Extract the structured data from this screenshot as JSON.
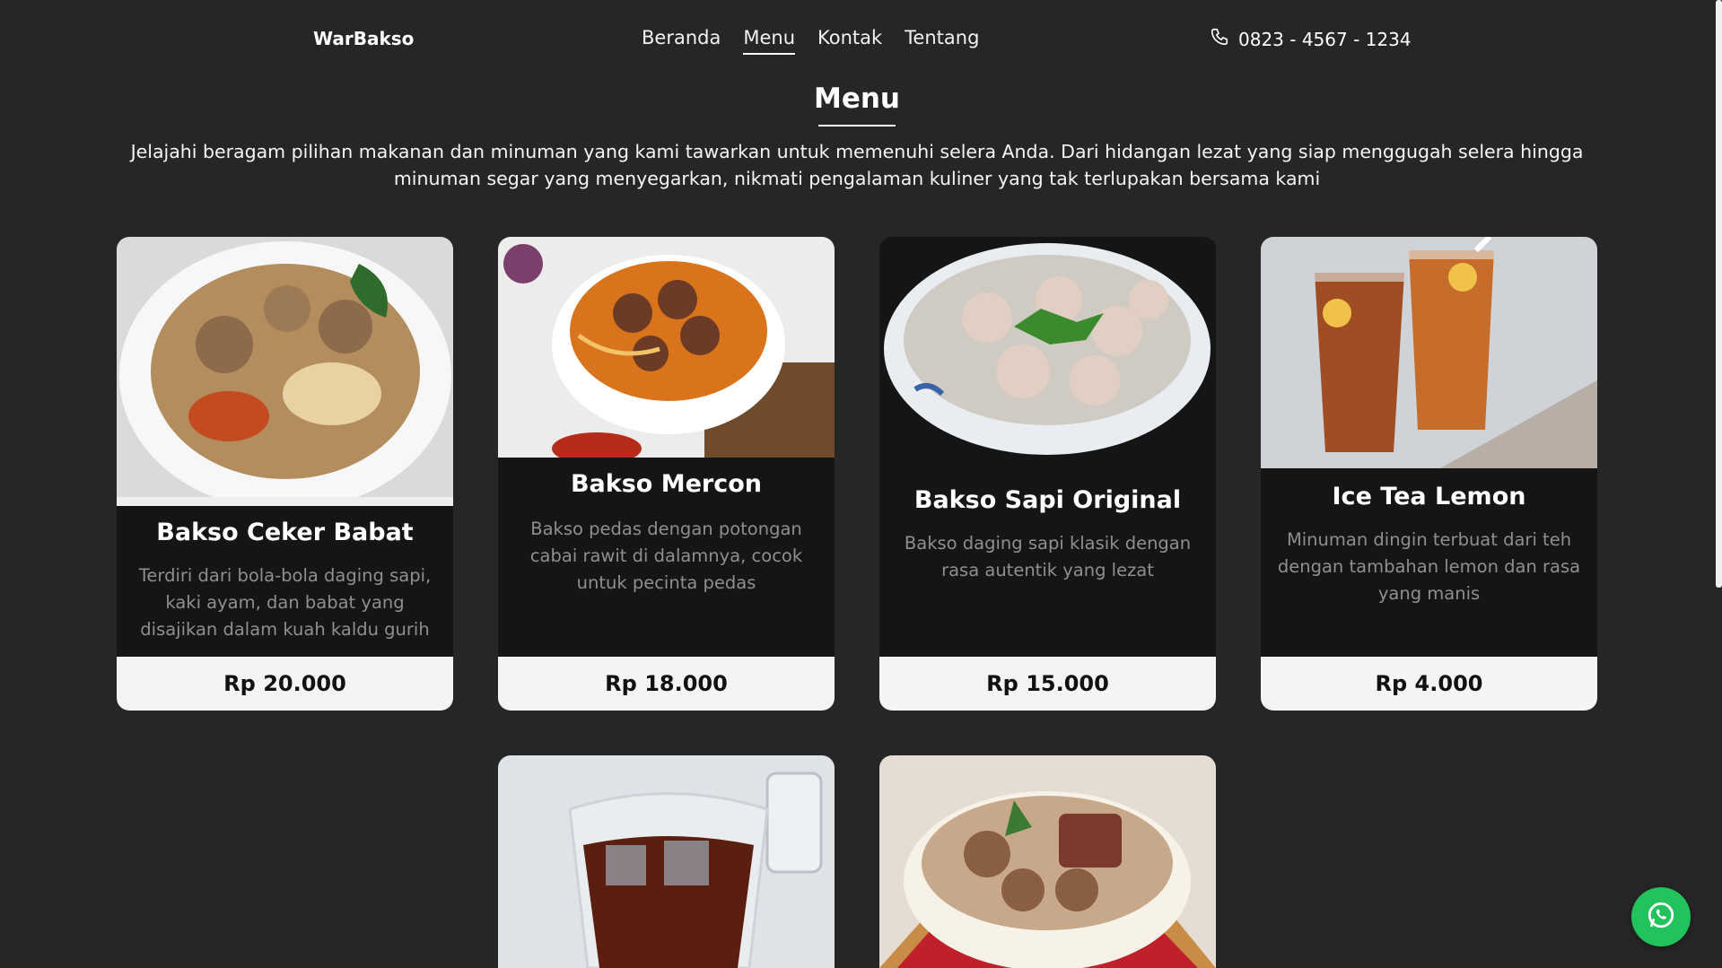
{
  "brand": "WarBakso",
  "nav": {
    "beranda": "Beranda",
    "menu": "Menu",
    "kontak": "Kontak",
    "tentang": "Tentang"
  },
  "phone": "0823 - 4567 - 1234",
  "section": {
    "title": "Menu",
    "intro": "Jelajahi beragam pilihan makanan dan minuman yang kami tawarkan untuk memenuhi selera Anda. Dari hidangan lezat yang siap menggugah selera hingga minuman segar yang menyegarkan, nikmati pengalaman kuliner yang tak terlupakan bersama kami"
  },
  "menu": [
    {
      "name": "Bakso Ceker Babat",
      "desc": "Terdiri dari bola-bola daging sapi, kaki ayam, dan babat yang disajikan dalam kuah kaldu gurih",
      "price": "Rp 20.000"
    },
    {
      "name": "Bakso Mercon",
      "desc": "Bakso pedas dengan potongan cabai rawit di dalamnya, cocok untuk pecinta pedas",
      "price": "Rp 18.000"
    },
    {
      "name": "Bakso Sapi Original",
      "desc": "Bakso daging sapi klasik dengan rasa autentik yang lezat",
      "price": "Rp 15.000"
    },
    {
      "name": "Ice Tea Lemon",
      "desc": "Minuman dingin terbuat dari teh dengan tambahan lemon dan rasa yang manis",
      "price": "Rp 4.000"
    }
  ],
  "icons": {
    "phone": "phone-icon",
    "whatsapp": "whatsapp-icon"
  },
  "colors": {
    "background": "#262626",
    "card": "#151515",
    "price_bar": "#f4f4f4",
    "whatsapp": "#22c25c"
  }
}
